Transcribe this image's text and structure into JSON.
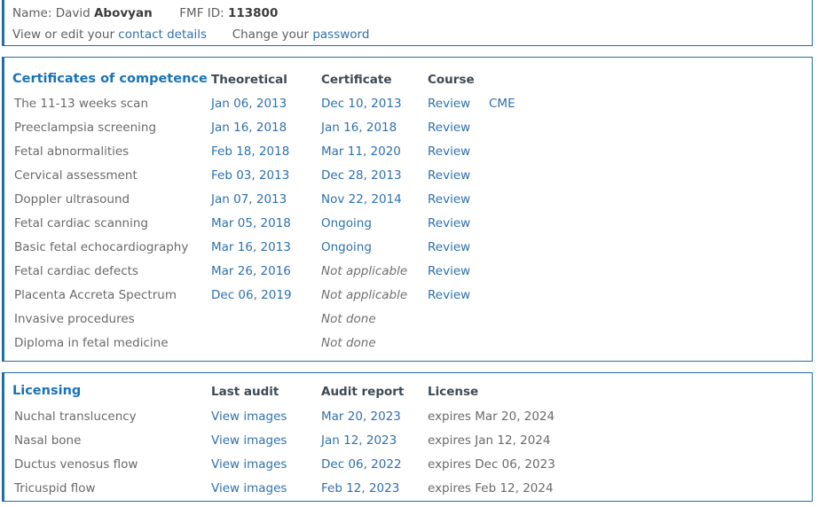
{
  "profile": {
    "name_label": "Name:",
    "first_name": "David",
    "last_name": "Abovyan",
    "fmf_id_label": "FMF ID:",
    "fmf_id": "113800",
    "view_edit_prefix": "View or edit your",
    "contact_details_link": "contact details",
    "change_prefix": "Change your",
    "password_link": "password"
  },
  "certificates": {
    "title": "Certificates of competence",
    "columns": {
      "theoretical": "Theoretical",
      "certificate": "Certificate",
      "course": "Course"
    },
    "rows": [
      {
        "name": "The 11-13 weeks scan",
        "theoretical": "Jan 06, 2013",
        "theoretical_type": "link",
        "certificate": "Dec 10, 2013",
        "certificate_type": "link",
        "course": "Review",
        "course_type": "link",
        "cme": "CME",
        "cme_type": "link"
      },
      {
        "name": "Preeclampsia screening",
        "theoretical": "Jan 16, 2018",
        "theoretical_type": "link",
        "certificate": "Jan 16, 2018",
        "certificate_type": "link",
        "course": "Review",
        "course_type": "link",
        "cme": "",
        "cme_type": "none"
      },
      {
        "name": "Fetal abnormalities",
        "theoretical": "Feb 18, 2018",
        "theoretical_type": "link",
        "certificate": "Mar 11, 2020",
        "certificate_type": "link",
        "course": "Review",
        "course_type": "link",
        "cme": "",
        "cme_type": "none"
      },
      {
        "name": "Cervical assessment",
        "theoretical": "Feb 03, 2013",
        "theoretical_type": "link",
        "certificate": "Dec 28, 2013",
        "certificate_type": "link",
        "course": "Review",
        "course_type": "link",
        "cme": "",
        "cme_type": "none"
      },
      {
        "name": "Doppler ultrasound",
        "theoretical": "Jan 07, 2013",
        "theoretical_type": "link",
        "certificate": "Nov 22, 2014",
        "certificate_type": "link",
        "course": "Review",
        "course_type": "link",
        "cme": "",
        "cme_type": "none"
      },
      {
        "name": "Fetal cardiac scanning",
        "theoretical": "Mar 05, 2018",
        "theoretical_type": "link",
        "certificate": "Ongoing",
        "certificate_type": "link",
        "course": "Review",
        "course_type": "link",
        "cme": "",
        "cme_type": "none"
      },
      {
        "name": "Basic fetal echocardiography",
        "theoretical": "Mar 16, 2013",
        "theoretical_type": "link",
        "certificate": "Ongoing",
        "certificate_type": "link",
        "course": "Review",
        "course_type": "link",
        "cme": "",
        "cme_type": "none"
      },
      {
        "name": "Fetal cardiac defects",
        "theoretical": "Mar 26, 2016",
        "theoretical_type": "link",
        "certificate": "Not applicable",
        "certificate_type": "muted",
        "course": "Review",
        "course_type": "link",
        "cme": "",
        "cme_type": "none"
      },
      {
        "name": "Placenta Accreta Spectrum",
        "theoretical": "Dec 06, 2019",
        "theoretical_type": "link",
        "certificate": "Not applicable",
        "certificate_type": "muted",
        "course": "Review",
        "course_type": "link",
        "cme": "",
        "cme_type": "none"
      },
      {
        "name": "Invasive procedures",
        "theoretical": "",
        "theoretical_type": "none",
        "certificate": "Not done",
        "certificate_type": "muted",
        "course": "",
        "course_type": "none",
        "cme": "",
        "cme_type": "none"
      },
      {
        "name": "Diploma in fetal medicine",
        "theoretical": "",
        "theoretical_type": "none",
        "certificate": "Not done",
        "certificate_type": "muted",
        "course": "",
        "course_type": "none",
        "cme": "",
        "cme_type": "none"
      }
    ]
  },
  "licensing": {
    "title": "Licensing",
    "columns": {
      "last_audit": "Last audit",
      "audit_report": "Audit report",
      "license": "License"
    },
    "rows": [
      {
        "name": "Nuchal translucency",
        "last_audit": "View images",
        "last_audit_type": "link",
        "audit_report": "Mar 20, 2023",
        "audit_report_type": "link",
        "license": "expires Mar 20, 2024",
        "license_type": "plain"
      },
      {
        "name": "Nasal bone",
        "last_audit": "View images",
        "last_audit_type": "link",
        "audit_report": "Jan 12, 2023",
        "audit_report_type": "link",
        "license": "expires Jan 12, 2024",
        "license_type": "plain"
      },
      {
        "name": "Ductus venosus flow",
        "last_audit": "View images",
        "last_audit_type": "link",
        "audit_report": "Dec 06, 2022",
        "audit_report_type": "link",
        "license": "expires Dec 06, 2023",
        "license_type": "plain"
      },
      {
        "name": "Tricuspid flow",
        "last_audit": "View images",
        "last_audit_type": "link",
        "audit_report": "Feb 12, 2023",
        "audit_report_type": "link",
        "license": "expires Feb 12, 2024",
        "license_type": "plain"
      }
    ]
  }
}
